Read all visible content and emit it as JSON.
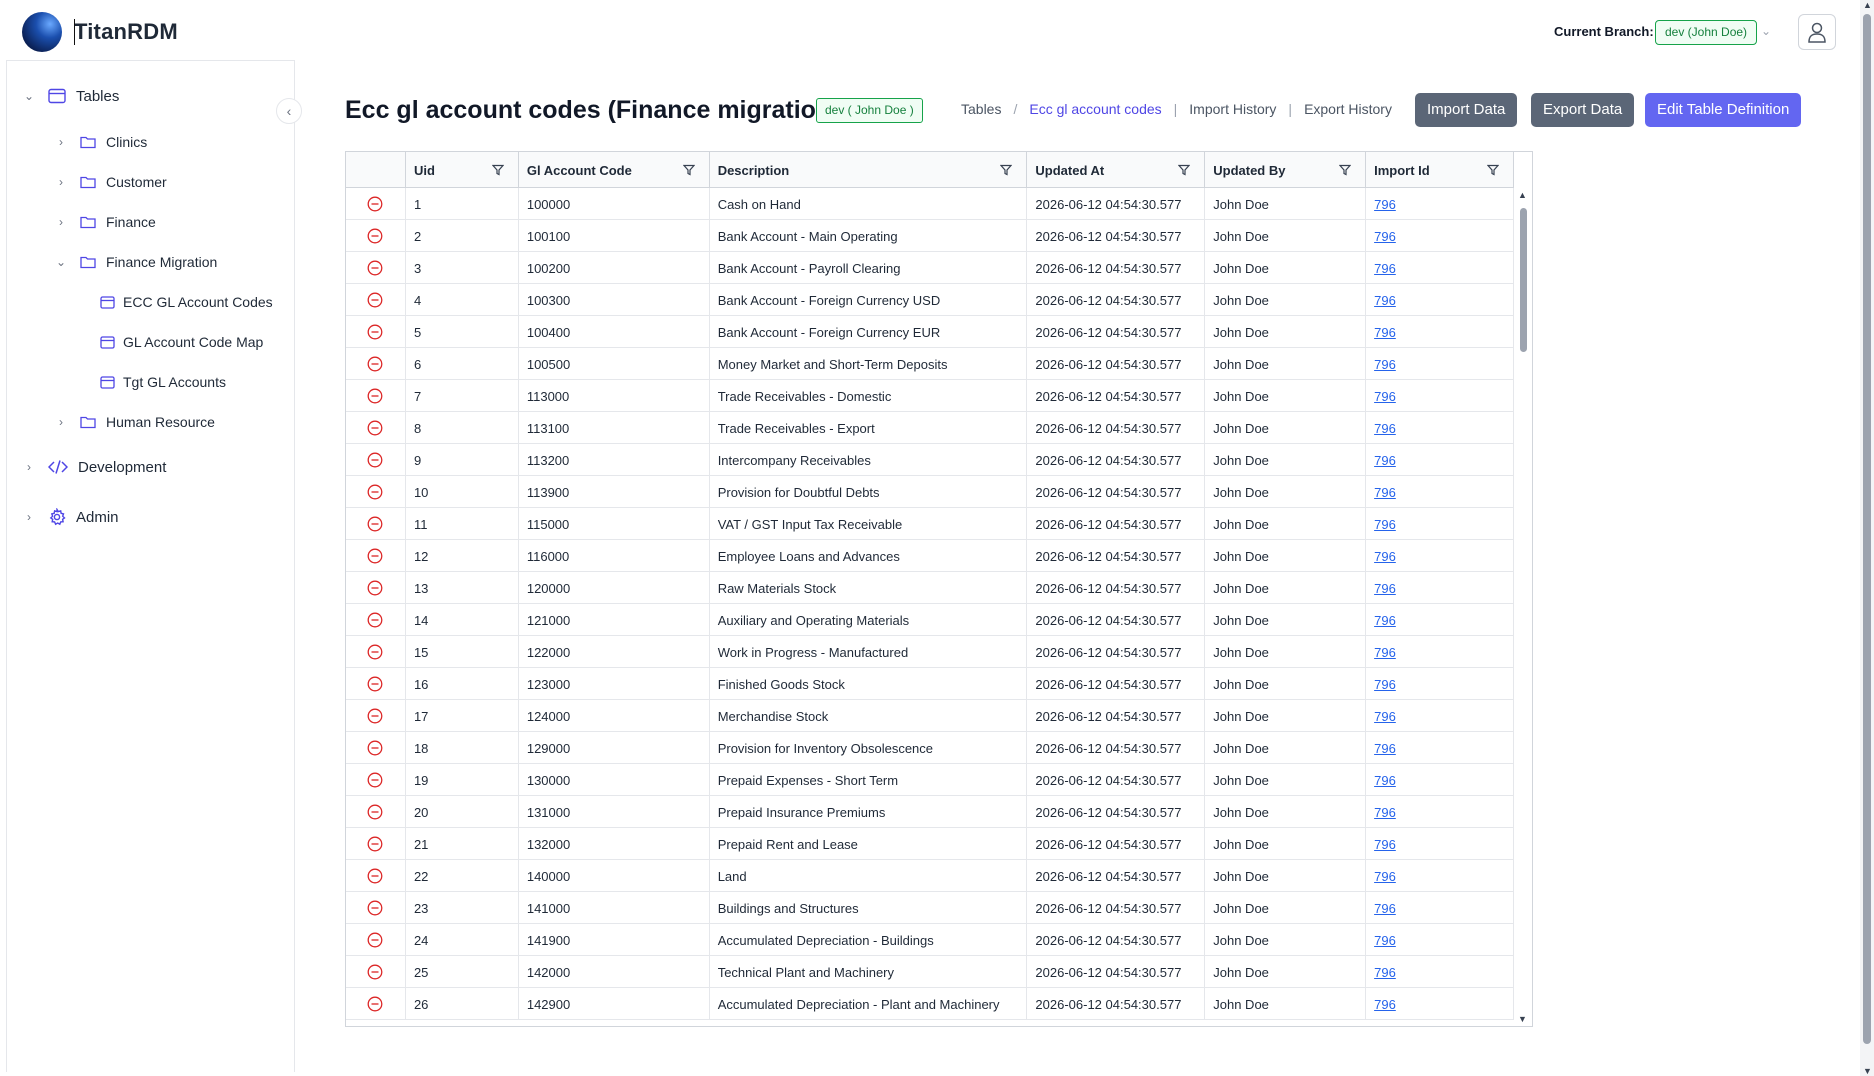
{
  "app": {
    "title": "TitanRDM"
  },
  "header": {
    "branch_label": "Current Branch:",
    "branch_value": "dev (John Doe)"
  },
  "sidebar": {
    "items": [
      {
        "label": "Tables",
        "icon": "table-icon",
        "expanded": true
      },
      {
        "label": "Clinics",
        "icon": "folder-icon"
      },
      {
        "label": "Customer",
        "icon": "folder-icon"
      },
      {
        "label": "Finance",
        "icon": "folder-icon"
      },
      {
        "label": "Finance Migration",
        "icon": "folder-icon",
        "expanded": true
      },
      {
        "label": "ECC GL Account Codes",
        "icon": "table-icon"
      },
      {
        "label": "GL Account Code Map",
        "icon": "table-icon"
      },
      {
        "label": "Tgt GL Accounts",
        "icon": "table-icon"
      },
      {
        "label": "Human Resource",
        "icon": "folder-icon"
      },
      {
        "label": "Development",
        "icon": "code-icon"
      },
      {
        "label": "Admin",
        "icon": "gear-icon"
      }
    ]
  },
  "main": {
    "title": "Ecc gl account codes (Finance migration)",
    "branch_badge": "dev ( John Doe )",
    "breadcrumb": {
      "tables": "Tables",
      "current": "Ecc gl account codes",
      "import_history": "Import History",
      "export_history": "Export History"
    },
    "buttons": {
      "import": "Import Data",
      "export": "Export Data",
      "edit": "Edit Table Definition"
    }
  },
  "table": {
    "columns": [
      "Uid",
      "Gl Account Code",
      "Description",
      "Updated At",
      "Updated By",
      "Import Id"
    ],
    "rows": [
      [
        "1",
        "100000",
        "Cash on Hand",
        "2026-06-12 04:54:30.577",
        "John Doe",
        "796"
      ],
      [
        "2",
        "100100",
        "Bank Account - Main Operating",
        "2026-06-12 04:54:30.577",
        "John Doe",
        "796"
      ],
      [
        "3",
        "100200",
        "Bank Account - Payroll Clearing",
        "2026-06-12 04:54:30.577",
        "John Doe",
        "796"
      ],
      [
        "4",
        "100300",
        "Bank Account - Foreign Currency USD",
        "2026-06-12 04:54:30.577",
        "John Doe",
        "796"
      ],
      [
        "5",
        "100400",
        "Bank Account - Foreign Currency EUR",
        "2026-06-12 04:54:30.577",
        "John Doe",
        "796"
      ],
      [
        "6",
        "100500",
        "Money Market and Short-Term Deposits",
        "2026-06-12 04:54:30.577",
        "John Doe",
        "796"
      ],
      [
        "7",
        "113000",
        "Trade Receivables - Domestic",
        "2026-06-12 04:54:30.577",
        "John Doe",
        "796"
      ],
      [
        "8",
        "113100",
        "Trade Receivables - Export",
        "2026-06-12 04:54:30.577",
        "John Doe",
        "796"
      ],
      [
        "9",
        "113200",
        "Intercompany Receivables",
        "2026-06-12 04:54:30.577",
        "John Doe",
        "796"
      ],
      [
        "10",
        "113900",
        "Provision for Doubtful Debts",
        "2026-06-12 04:54:30.577",
        "John Doe",
        "796"
      ],
      [
        "11",
        "115000",
        "VAT / GST Input Tax Receivable",
        "2026-06-12 04:54:30.577",
        "John Doe",
        "796"
      ],
      [
        "12",
        "116000",
        "Employee Loans and Advances",
        "2026-06-12 04:54:30.577",
        "John Doe",
        "796"
      ],
      [
        "13",
        "120000",
        "Raw Materials Stock",
        "2026-06-12 04:54:30.577",
        "John Doe",
        "796"
      ],
      [
        "14",
        "121000",
        "Auxiliary and Operating Materials",
        "2026-06-12 04:54:30.577",
        "John Doe",
        "796"
      ],
      [
        "15",
        "122000",
        "Work in Progress - Manufactured",
        "2026-06-12 04:54:30.577",
        "John Doe",
        "796"
      ],
      [
        "16",
        "123000",
        "Finished Goods Stock",
        "2026-06-12 04:54:30.577",
        "John Doe",
        "796"
      ],
      [
        "17",
        "124000",
        "Merchandise Stock",
        "2026-06-12 04:54:30.577",
        "John Doe",
        "796"
      ],
      [
        "18",
        "129000",
        "Provision for Inventory Obsolescence",
        "2026-06-12 04:54:30.577",
        "John Doe",
        "796"
      ],
      [
        "19",
        "130000",
        "Prepaid Expenses - Short Term",
        "2026-06-12 04:54:30.577",
        "John Doe",
        "796"
      ],
      [
        "20",
        "131000",
        "Prepaid Insurance Premiums",
        "2026-06-12 04:54:30.577",
        "John Doe",
        "796"
      ],
      [
        "21",
        "132000",
        "Prepaid Rent and Lease",
        "2026-06-12 04:54:30.577",
        "John Doe",
        "796"
      ],
      [
        "22",
        "140000",
        "Land",
        "2026-06-12 04:54:30.577",
        "John Doe",
        "796"
      ],
      [
        "23",
        "141000",
        "Buildings and Structures",
        "2026-06-12 04:54:30.577",
        "John Doe",
        "796"
      ],
      [
        "24",
        "141900",
        "Accumulated Depreciation - Buildings",
        "2026-06-12 04:54:30.577",
        "John Doe",
        "796"
      ],
      [
        "25",
        "142000",
        "Technical Plant and Machinery",
        "2026-06-12 04:54:30.577",
        "John Doe",
        "796"
      ],
      [
        "26",
        "142900",
        "Accumulated Depreciation - Plant and Machinery",
        "2026-06-12 04:54:30.577",
        "John Doe",
        "796"
      ]
    ]
  },
  "colors": {
    "accent": "#4f46e5",
    "button_gray": "#5b6677",
    "button_indigo": "#6366f1",
    "branch_green": "#16a34a",
    "delete_red": "#dc2626",
    "link_blue": "#2563eb"
  }
}
